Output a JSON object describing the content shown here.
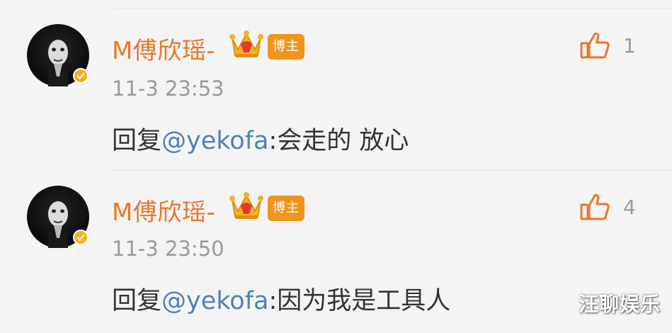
{
  "comments": [
    {
      "username": "M傅欣瑶-",
      "badge": "博主",
      "timestamp": "11-3 23:53",
      "reply_prefix": "回复",
      "mention": "@yekofa",
      "reply_body": ":会走的 放心",
      "likes": "1"
    },
    {
      "username": "M傅欣瑶-",
      "badge": "博主",
      "timestamp": "11-3 23:50",
      "reply_prefix": "回复",
      "mention": "@yekofa",
      "reply_body": ":因为我是工具人",
      "likes": "4"
    }
  ],
  "watermark": "汪聊娱乐",
  "icons": {
    "avatar": "avatar-image",
    "verified": "verified-badge-icon",
    "crown": "crown-icon",
    "like": "thumbs-up-icon"
  },
  "colors": {
    "username": "#e8762b",
    "badge_bg": "#f0941e",
    "mention": "#557fb2",
    "timestamp": "#9a9a9a",
    "text": "#333333",
    "verified": "#f5b11b"
  }
}
